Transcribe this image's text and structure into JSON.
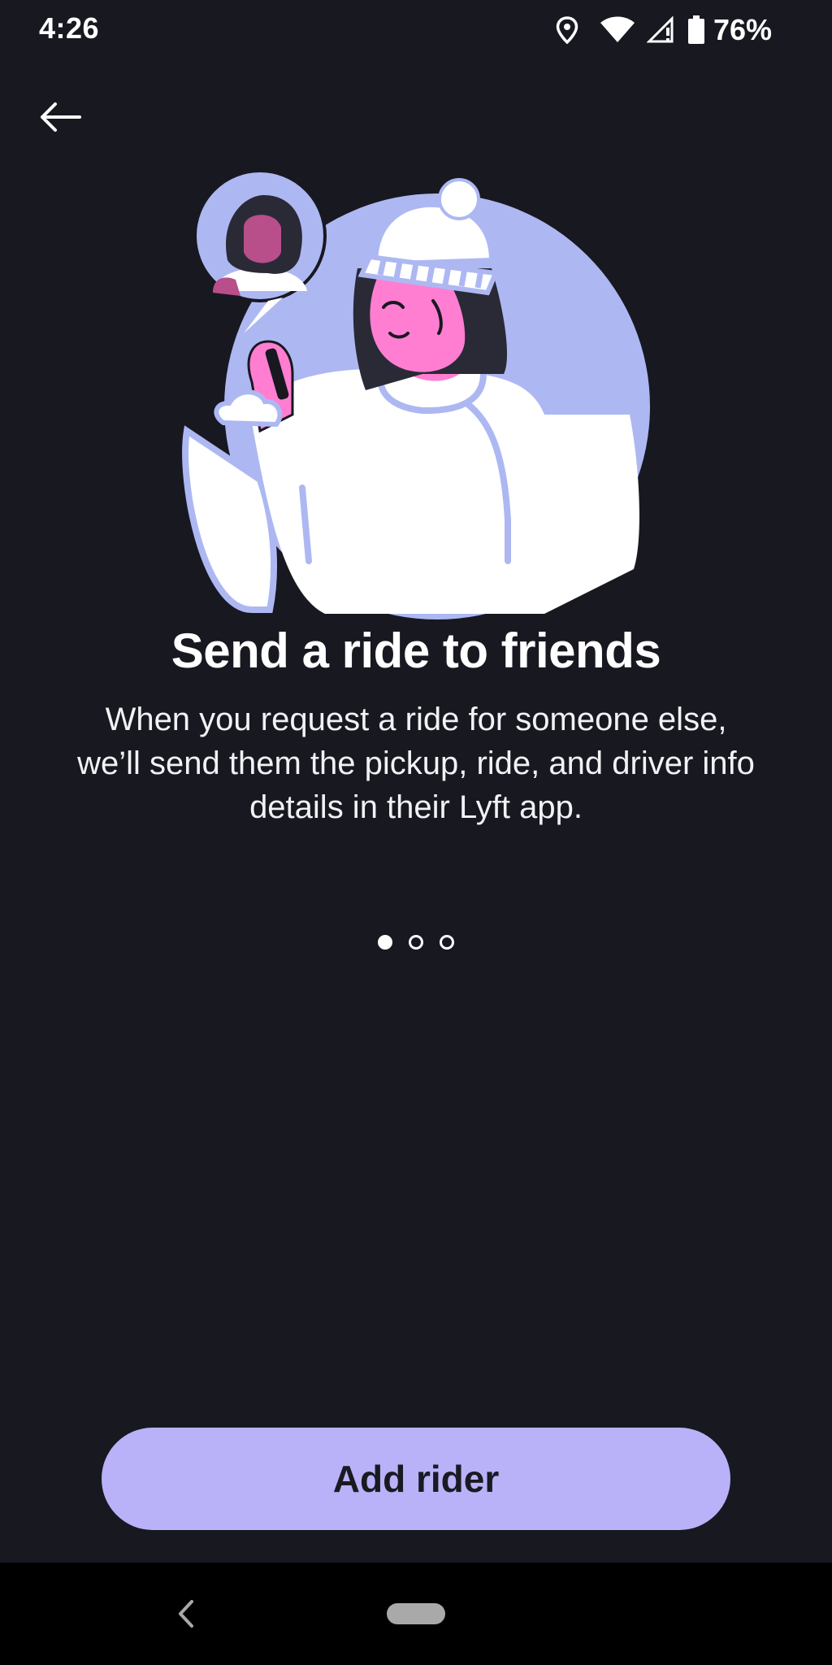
{
  "status_bar": {
    "time": "4:26",
    "battery_percent": "76%",
    "icons": [
      "location-icon",
      "wifi-icon",
      "signal-icon",
      "battery-icon"
    ]
  },
  "header": {
    "back_icon": "arrow-left-icon"
  },
  "onboarding": {
    "illustration": "person-sending-ride-illustration",
    "title": "Send a ride to friends",
    "body": "When you request a ride for someone else, we’ll send them the pickup, ride, and driver info details in their Lyft app.",
    "pager": {
      "total": 3,
      "active_index": 0
    }
  },
  "actions": {
    "primary_label": "Add rider"
  },
  "colors": {
    "background": "#181821",
    "accent": "#b9b2f8",
    "illustration_circle": "#adb8f2",
    "skin_pink": "#ff7ed1"
  },
  "nav_bar": {
    "back_icon": "chevron-left-icon",
    "home_icon": "home-pill-icon"
  }
}
